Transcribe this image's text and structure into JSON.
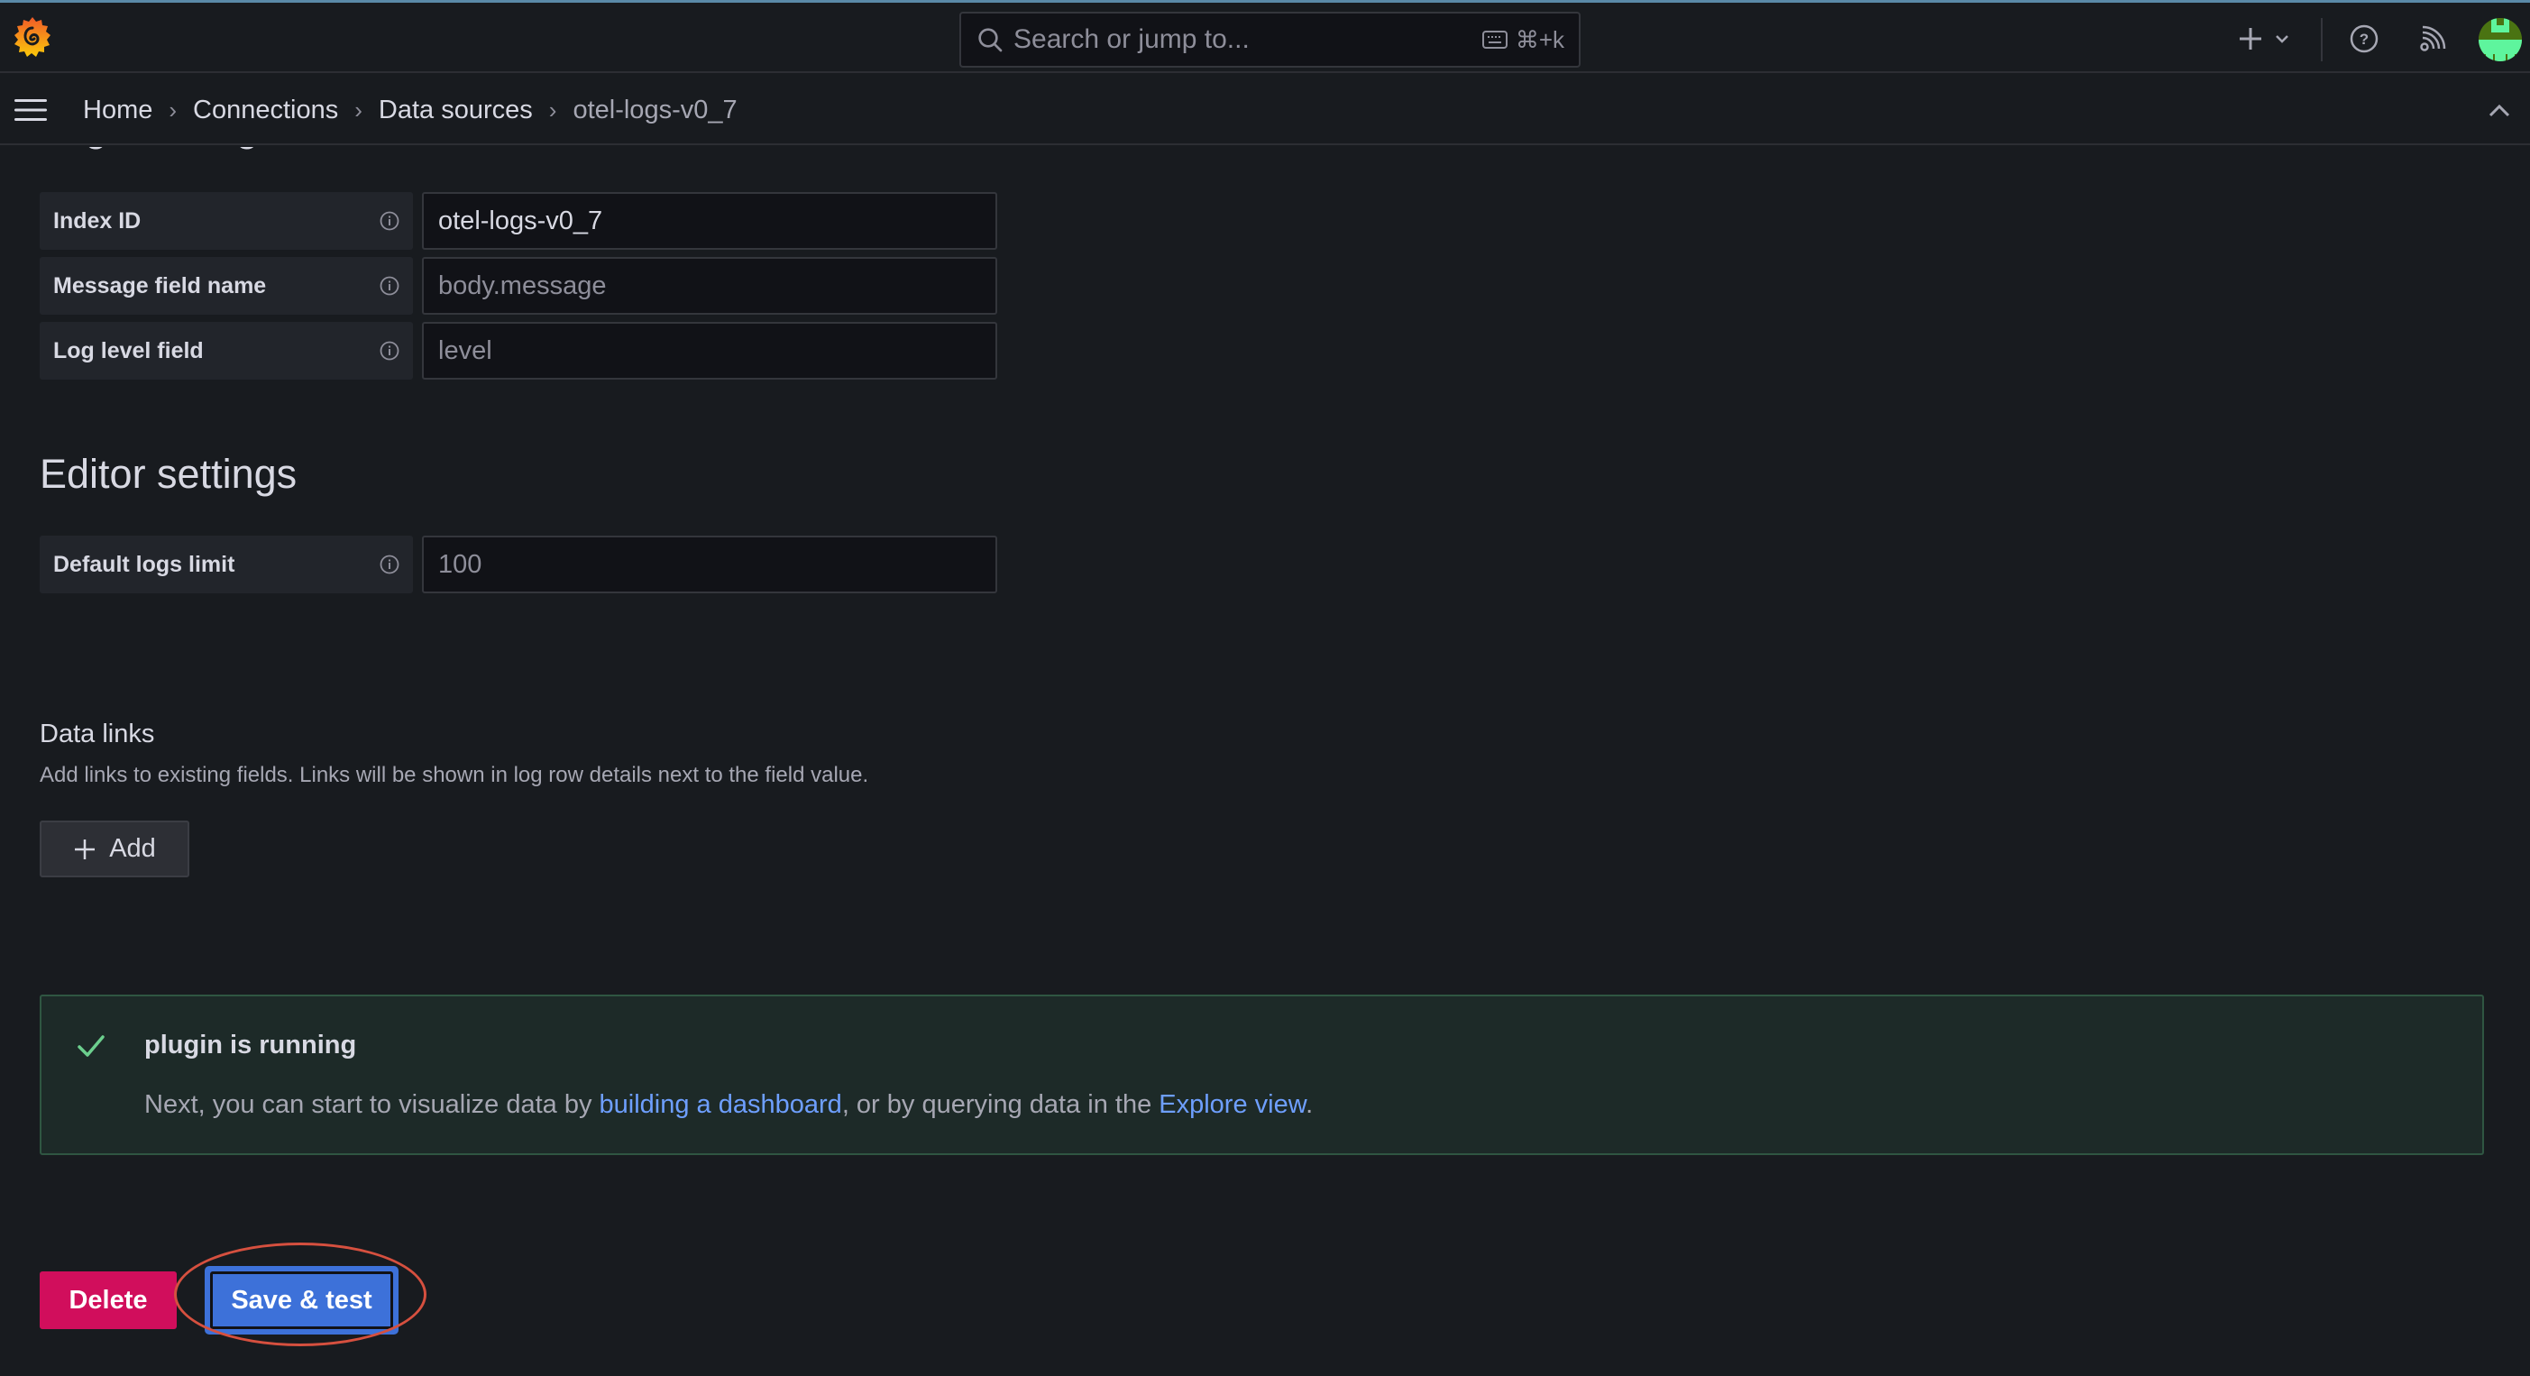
{
  "topbar": {
    "search_placeholder": "Search or jump to...",
    "search_shortcut": "⌘+k",
    "icons": [
      "grafana-logo",
      "search-icon",
      "keyboard-icon",
      "plus-icon",
      "chevron-down-icon",
      "help-icon",
      "rss-icon",
      "avatar"
    ]
  },
  "breadcrumb": {
    "items": [
      "Home",
      "Connections",
      "Data sources",
      "otel-logs-v0_7"
    ],
    "separator": "›"
  },
  "logs_settings": {
    "heading_partial": "Logs settings",
    "fields": [
      {
        "label": "Index ID",
        "value": "otel-logs-v0_7",
        "placeholder": ""
      },
      {
        "label": "Message field name",
        "value": "",
        "placeholder": "body.message"
      },
      {
        "label": "Log level field",
        "value": "",
        "placeholder": "level"
      }
    ]
  },
  "editor_settings": {
    "title": "Editor settings",
    "fields": [
      {
        "label": "Default logs limit",
        "value": "",
        "placeholder": "100"
      }
    ]
  },
  "data_links": {
    "title": "Data links",
    "description": "Add links to existing fields. Links will be shown in log row details next to the field value.",
    "add_label": "Add"
  },
  "alert": {
    "status": "success",
    "title": "plugin is running",
    "body_prefix": "Next, you can start to visualize data by ",
    "link1": "building a dashboard",
    "body_middle": ", or by querying data in the ",
    "link2": "Explore view",
    "body_suffix": "."
  },
  "actions": {
    "delete_label": "Delete",
    "save_label": "Save & test"
  },
  "colors": {
    "background": "#181b1f",
    "primary": "#3d71d9",
    "destructive": "#d10e5c",
    "success_border": "#2f5642",
    "link": "#6e9fff",
    "annotation": "#d6503f"
  }
}
